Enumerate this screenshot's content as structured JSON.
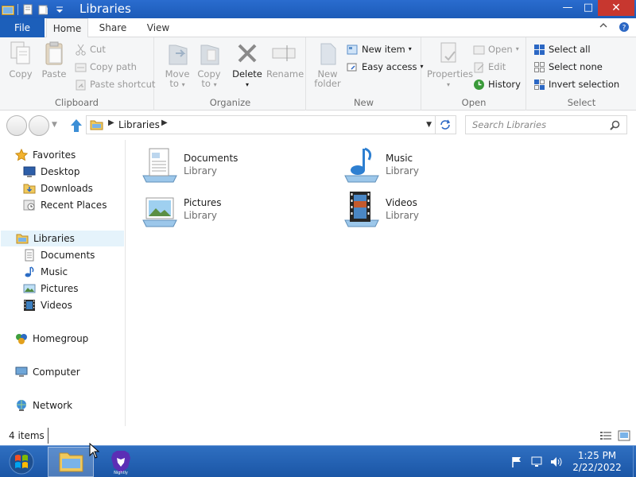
{
  "window": {
    "title": "Libraries",
    "controls": {
      "minimize": "—",
      "maximize": "□",
      "close": "✕"
    }
  },
  "ribbon": {
    "tabs": [
      {
        "label": "File"
      },
      {
        "label": "Home"
      },
      {
        "label": "Share"
      },
      {
        "label": "View"
      }
    ],
    "groups": {
      "clipboard": {
        "label": "Clipboard",
        "copy": "Copy",
        "paste": "Paste",
        "cut": "Cut",
        "copy_path": "Copy path",
        "paste_shortcut": "Paste shortcut"
      },
      "organize": {
        "label": "Organize",
        "move_to": "Move to",
        "copy_to": "Copy to",
        "delete": "Delete",
        "rename": "Rename"
      },
      "new": {
        "label": "New",
        "new_folder": "New folder",
        "new_item": "New item",
        "easy_access": "Easy access"
      },
      "open": {
        "label": "Open",
        "properties": "Properties",
        "open": "Open",
        "edit": "Edit",
        "history": "History"
      },
      "select": {
        "label": "Select",
        "select_all": "Select all",
        "select_none": "Select none",
        "invert_selection": "Invert selection"
      }
    }
  },
  "address_bar": {
    "breadcrumb": "Libraries",
    "search_placeholder": "Search Libraries"
  },
  "nav_pane": {
    "favorites": {
      "label": "Favorites",
      "items": [
        {
          "label": "Desktop"
        },
        {
          "label": "Downloads"
        },
        {
          "label": "Recent Places"
        }
      ]
    },
    "libraries": {
      "label": "Libraries",
      "items": [
        {
          "label": "Documents"
        },
        {
          "label": "Music"
        },
        {
          "label": "Pictures"
        },
        {
          "label": "Videos"
        }
      ]
    },
    "homegroup": "Homegroup",
    "computer": "Computer",
    "network": "Network"
  },
  "content": {
    "libraries": [
      {
        "name": "Documents",
        "type": "Library",
        "icon": "documents-library-icon"
      },
      {
        "name": "Music",
        "type": "Library",
        "icon": "music-library-icon"
      },
      {
        "name": "Pictures",
        "type": "Library",
        "icon": "pictures-library-icon"
      },
      {
        "name": "Videos",
        "type": "Library",
        "icon": "videos-library-icon"
      }
    ]
  },
  "status_bar": {
    "item_count": "4 items"
  },
  "taskbar": {
    "time": "1:25 PM",
    "date": "2/22/2022",
    "brave_label": "Nightly"
  },
  "colors": {
    "titlebar": "#1c5bb8",
    "file_tab": "#1c5fba",
    "selection": "#e5f3fb",
    "taskbar": "#2a65b6"
  }
}
